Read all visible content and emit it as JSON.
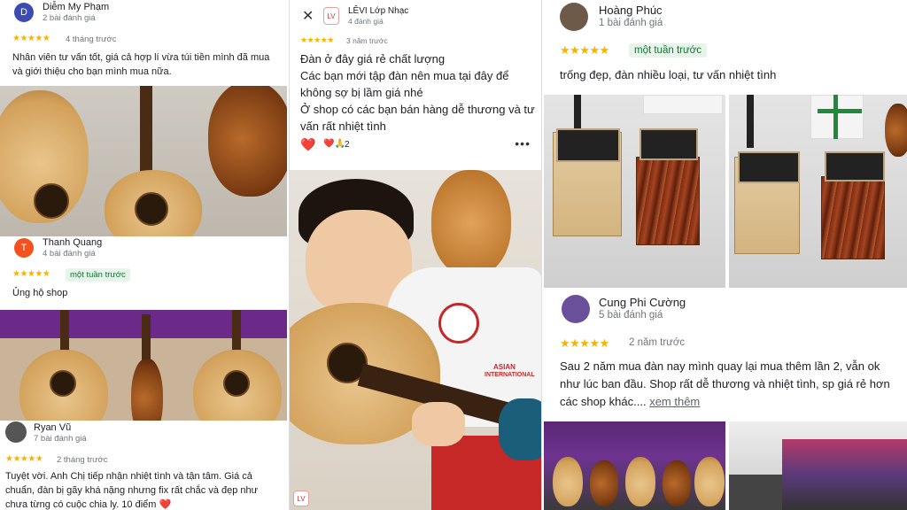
{
  "panel1": {
    "reviews": [
      {
        "avatar_letter": "D",
        "avatar_color": "#3c4bb0",
        "name": "Diễm My Phạm",
        "meta": "2 bài đánh giá",
        "stars": "★★★★★",
        "when": "4 tháng trước",
        "badge": "",
        "text": "Nhân viên tư vấn tốt, giá cả hợp lí vừa túi tiền mình đã mua và giới thiệu cho bạn mình mua nữa."
      },
      {
        "avatar_letter": "T",
        "avatar_color": "#f4511e",
        "name": "Thanh Quang",
        "meta": "4 bài đánh giá",
        "stars": "★★★★★",
        "when": "",
        "badge": "một tuần trước",
        "text": "Ủng hộ shop"
      },
      {
        "avatar_letter": "",
        "avatar_color": "#555555",
        "name": "Ryan Vũ",
        "meta": "7 bài đánh giá",
        "stars": "★★★★★",
        "when": "2 tháng trước",
        "badge": "",
        "text": "Tuyệt vời. Anh Chị tiếp nhận nhiệt tình và tận tâm. Giá cả chuẩn, đàn bị gãy khá nặng nhưng fix rất chắc và đẹp như chưa từng có cuộc chia ly. 10 điểm ❤️"
      }
    ]
  },
  "panel2": {
    "close_icon": "✕",
    "shop_logo_text": "LV",
    "shop_name": "LÊVI Lớp Nhạc",
    "shop_meta": "4 đánh giá",
    "stars": "★★★★★",
    "when": "3 năm trước",
    "text_lines": [
      "Đàn ở đây giá rẻ chất lượng",
      "Các bạn mới tập đàn nên mua tại đây để không sợ bị lầm giá nhé",
      "Ở shop có các bạn bán hàng dễ thương và tư vấn rất nhiệt tình"
    ],
    "heart": "❤️",
    "reactions": "❤️🙏",
    "reaction_count": "2",
    "more_icon": "•••",
    "photo_text_1": "ASIAN",
    "photo_text_2": "INTERNATIONAL",
    "watermark": "LV"
  },
  "panel3": {
    "reviews": [
      {
        "avatar_color": "#6d5a48",
        "name": "Hoàng Phúc",
        "meta": "1 bài đánh giá",
        "stars": "★★★★★",
        "when": "",
        "badge": "một tuần trước",
        "text": "trống đẹp, đàn nhiều loại, tư vấn nhiệt tình",
        "more": ""
      },
      {
        "avatar_color": "#6a4f9a",
        "name": "Cung Phi Cường",
        "meta": "5 bài đánh giá",
        "stars": "★★★★★",
        "when": "2 năm trước",
        "badge": "",
        "text": "Sau 2 năm mua đàn nay mình quay lại mua thêm lần 2, vẫn ok như lúc ban đầu. Shop rất dễ thương và nhiệt tình, sp giá rẻ hơn các shop khác....",
        "more": "xem thêm"
      }
    ]
  }
}
